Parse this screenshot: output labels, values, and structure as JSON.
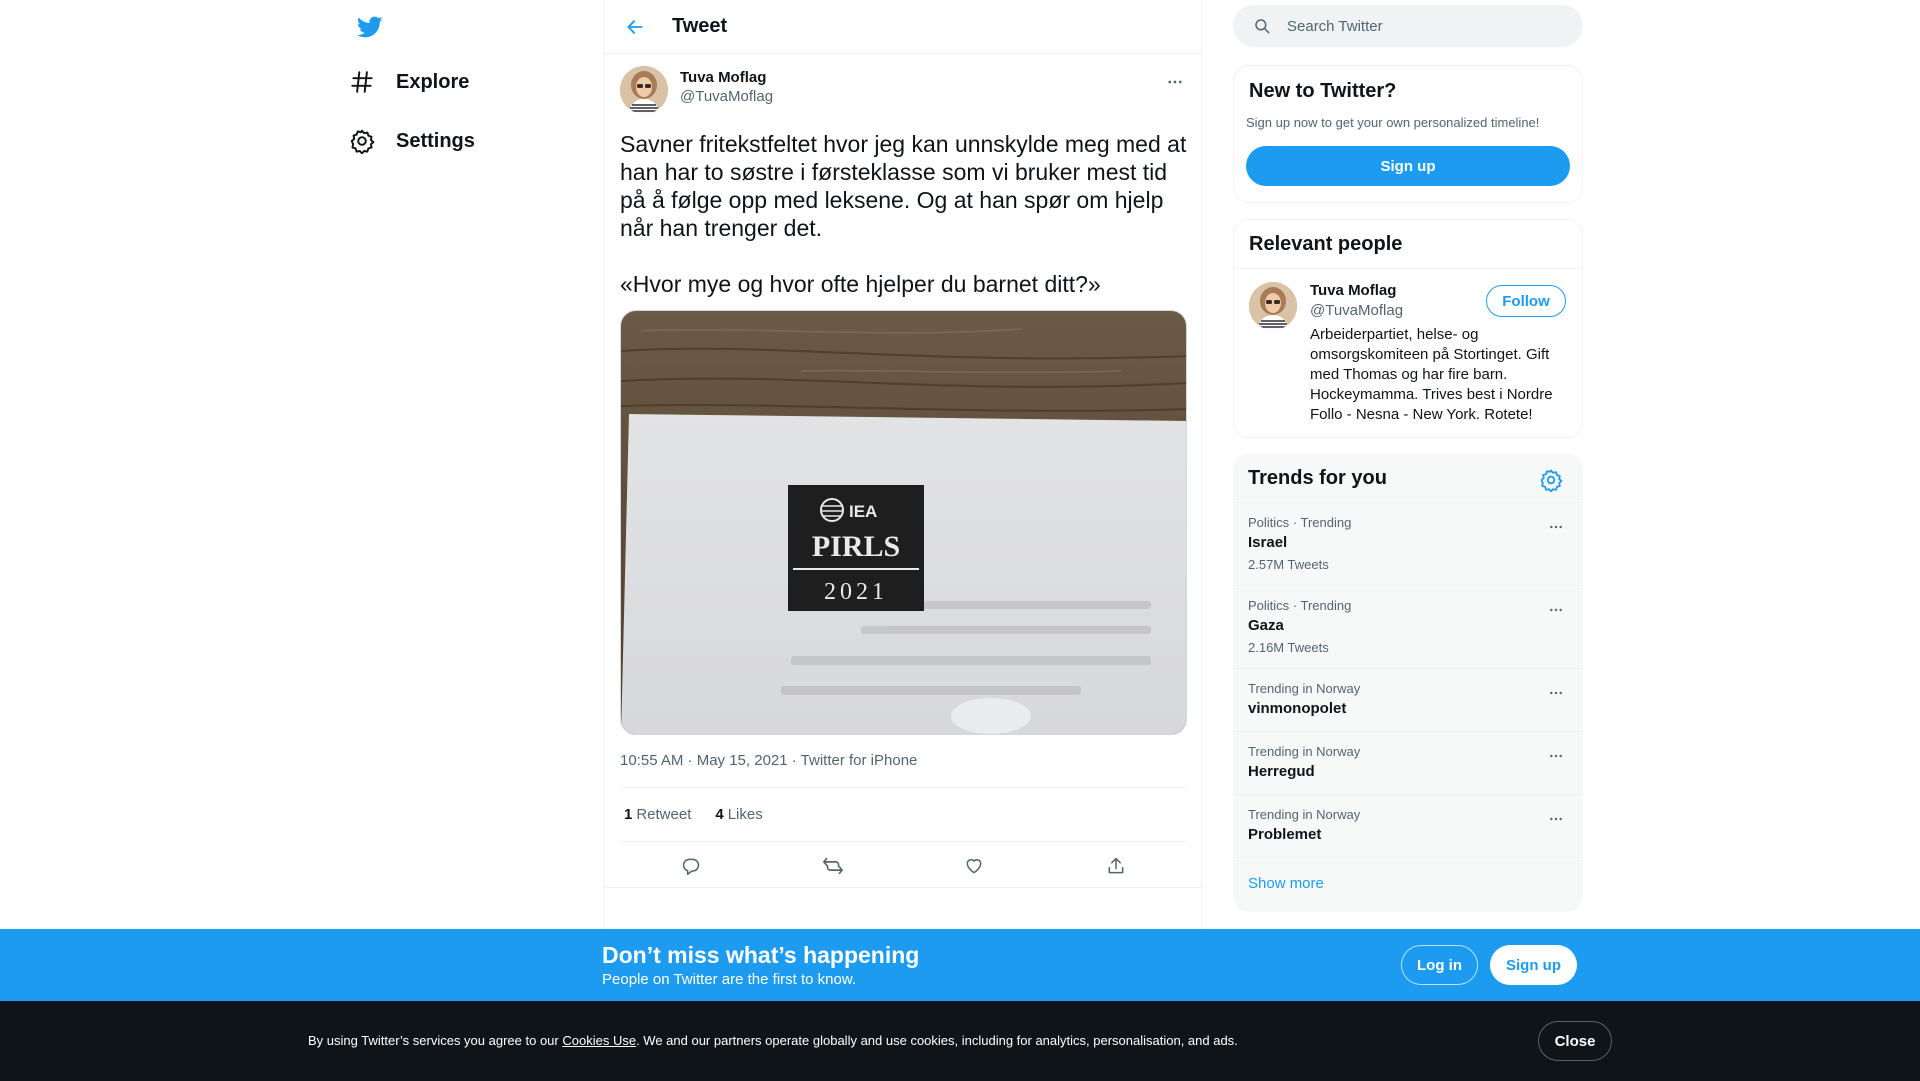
{
  "colors": {
    "accent": "#1d9bf0",
    "text": "#0f1419",
    "muted": "#536471",
    "cookie_bg": "#0f1419"
  },
  "nav": {
    "logo_icon": "twitter-bird-icon",
    "items": [
      {
        "label": "Explore",
        "icon": "hashtag-icon"
      },
      {
        "label": "Settings",
        "icon": "gear-icon"
      }
    ]
  },
  "main": {
    "title": "Tweet",
    "tweet": {
      "author_name": "Tuva Moflag",
      "author_handle": "@TuvaMoflag",
      "text": "Savner fritekstfeltet hvor jeg kan unnskylde meg med at han har to søstre i førsteklasse som vi bruker mest tid på å følge opp med leksene. Og at han spør om hjelp når han trenger det.\n\n«Hvor mye og hvor ofte hjelper du barnet ditt?»",
      "media": {
        "line1": "IEA",
        "line2": "PIRLS",
        "line3": "2021"
      },
      "meta": "10:55 AM · May 15, 2021 · Twitter for iPhone",
      "retweets_count": "1",
      "retweets_label": "Retweet",
      "likes_count": "4",
      "likes_label": "Likes"
    }
  },
  "search": {
    "placeholder": "Search Twitter"
  },
  "new_to_twitter": {
    "title": "New to Twitter?",
    "subtitle": "Sign up now to get your own personalized timeline!",
    "button": "Sign up"
  },
  "relevant_people": {
    "title": "Relevant people",
    "person": {
      "name": "Tuva Moflag",
      "handle": "@TuvaMoflag",
      "follow": "Follow",
      "bio": "Arbeiderpartiet, helse- og omsorgskomiteen på Stortinget. Gift med Thomas og har fire barn. Hockeymamma. Trives best i Nordre Follo - Nesna - New York. Rotete!"
    }
  },
  "trends": {
    "title": "Trends for you",
    "items": [
      {
        "context": "Politics · Trending",
        "name": "Israel",
        "count": "2.57M Tweets"
      },
      {
        "context": "Politics · Trending",
        "name": "Gaza",
        "count": "2.16M Tweets"
      },
      {
        "context": "Trending in Norway",
        "name": "vinmonopolet",
        "count": ""
      },
      {
        "context": "Trending in Norway",
        "name": "Herregud",
        "count": ""
      },
      {
        "context": "Trending in Norway",
        "name": "Problemet",
        "count": ""
      }
    ],
    "show_more": "Show more"
  },
  "banner": {
    "title": "Don’t miss what’s happening",
    "subtitle": "People on Twitter are the first to know.",
    "login": "Log in",
    "signup": "Sign up"
  },
  "cookie": {
    "text_before": "By using Twitter’s services you agree to our ",
    "link": "Cookies Use",
    "text_after": ". We and our partners operate globally and use cookies, including for analytics, personalisation, and ads.",
    "close": "Close"
  }
}
